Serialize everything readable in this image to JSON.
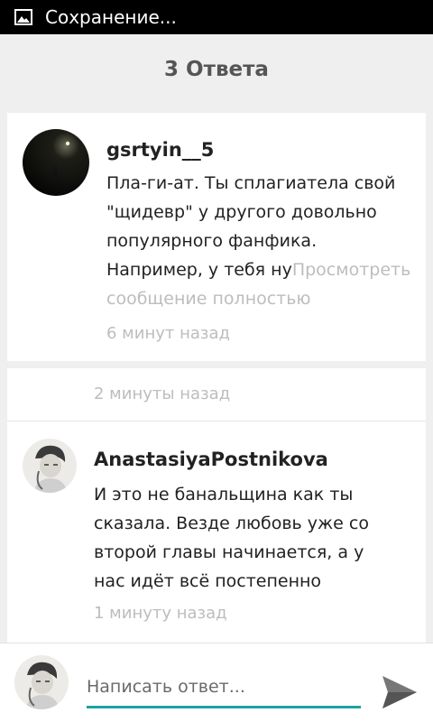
{
  "status_bar": {
    "text": "Сохранение...",
    "icon": "image-icon"
  },
  "header": {
    "title": "3 Ответа"
  },
  "comments": [
    {
      "author": "gsrtyin__5",
      "text": "Пла-ги-ат.  Ты сплагиатела свой \"щидевр\" у другого довольно популярного фанфика. Например, у тебя ну",
      "more_label": "Просмотреть сообщение полностью",
      "time": "6 минут назад"
    },
    {
      "header_time": "2 минуты назад",
      "author": "AnastasiyaPostnikova",
      "text": "И это не банальщина как ты сказала. Везде любовь уже со второй главы начинается, а у нас идёт всё постепенно",
      "time": "1 минуту назад"
    }
  ],
  "reply": {
    "placeholder": "Написать ответ...",
    "send_icon": "send-icon"
  }
}
